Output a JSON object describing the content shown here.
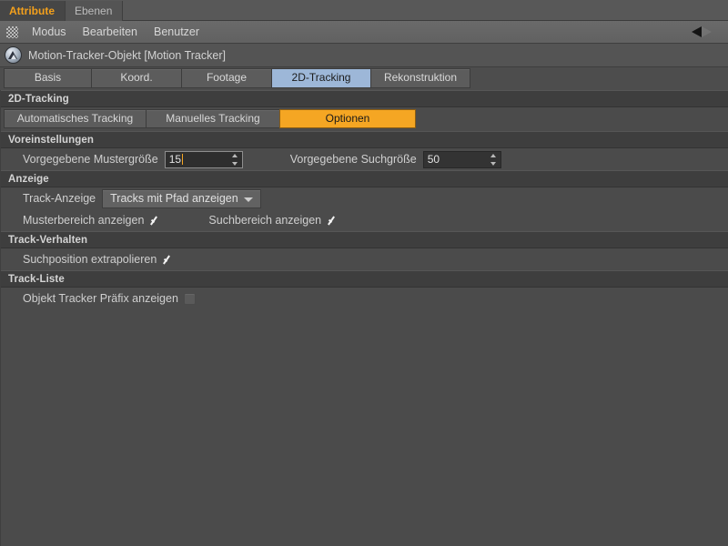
{
  "panel_tabs": [
    {
      "label": "Attribute",
      "active": true
    },
    {
      "label": "Ebenen",
      "active": false
    }
  ],
  "menubar": {
    "grip_icon": "grip-dots-icon",
    "items": [
      "Modus",
      "Bearbeiten",
      "Benutzer"
    ],
    "collapse_icon": "left-triangle-icon"
  },
  "object_header": {
    "icon": "motion-tracker-icon",
    "title": "Motion-Tracker-Objekt [Motion Tracker]"
  },
  "tabs": [
    {
      "label": "Basis",
      "selected": false
    },
    {
      "label": "Koord.",
      "selected": false
    },
    {
      "label": "Footage",
      "selected": false
    },
    {
      "label": "2D-Tracking",
      "selected": true
    },
    {
      "label": "Rekonstruktion",
      "selected": false
    }
  ],
  "sections": {
    "tracking": {
      "header": "2D-Tracking",
      "subtabs": [
        {
          "label": "Automatisches Tracking",
          "selected": false
        },
        {
          "label": "Manuelles Tracking",
          "selected": false
        },
        {
          "label": "Optionen",
          "selected": true
        }
      ]
    },
    "voreinstellungen": {
      "header": "Voreinstellungen",
      "muster_label": "Vorgegebene Mustergröße",
      "muster_value": "15",
      "muster_focused": true,
      "such_label": "Vorgegebene Suchgröße",
      "such_value": "50",
      "spinner_icon": "spinner-up-down-icon"
    },
    "anzeige": {
      "header": "Anzeige",
      "track_anzeige_label": "Track-Anzeige",
      "track_anzeige_value": "Tracks mit Pfad anzeigen",
      "dropdown_icon": "chevron-down-icon",
      "musterbereich_label": "Musterbereich anzeigen",
      "musterbereich_checked": true,
      "suchbereich_label": "Suchbereich anzeigen",
      "suchbereich_checked": true
    },
    "track_verhalten": {
      "header": "Track-Verhalten",
      "extrapolieren_label": "Suchposition extrapolieren",
      "extrapolieren_checked": true
    },
    "track_liste": {
      "header": "Track-Liste",
      "praefix_label": "Objekt Tracker Präfix anzeigen",
      "praefix_checked": false
    }
  },
  "colors": {
    "accent_orange": "#f5a623",
    "tab_selected_blue": "#9db7d8",
    "background": "#4b4b4b",
    "section_header": "#3e3e3e"
  }
}
